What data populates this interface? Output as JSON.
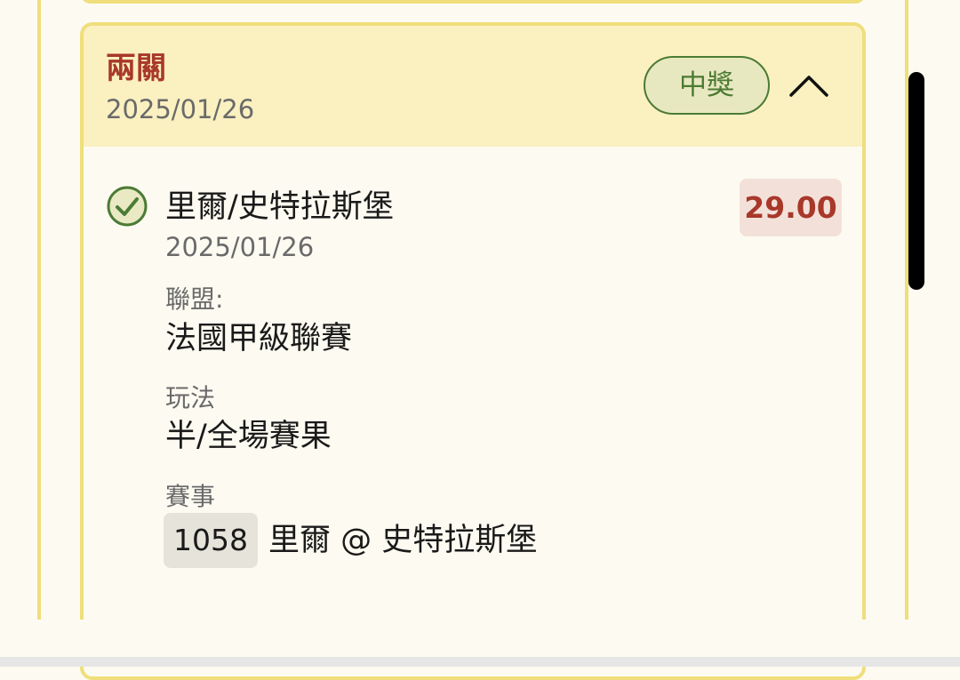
{
  "card": {
    "title": "兩關",
    "date": "2025/01/26",
    "status": "中獎",
    "toggle_icon": "chevron-up-icon"
  },
  "selection": {
    "status_icon": "check-circle-icon",
    "name": "里爾/史特拉斯堡",
    "date": "2025/01/26",
    "odds": "29.00",
    "league_label": "聯盟:",
    "league_value": "法國甲級聯賽",
    "bet_type_label": "玩法",
    "bet_type_value": "半/全場賽果",
    "match_label": "賽事",
    "match_number": "1058",
    "match_name": "里爾 @ 史特拉斯堡"
  },
  "colors": {
    "accent_red": "#a8382a",
    "accent_green": "#4b7b34",
    "card_border": "#efde7b",
    "header_bg": "#faf0c0"
  }
}
